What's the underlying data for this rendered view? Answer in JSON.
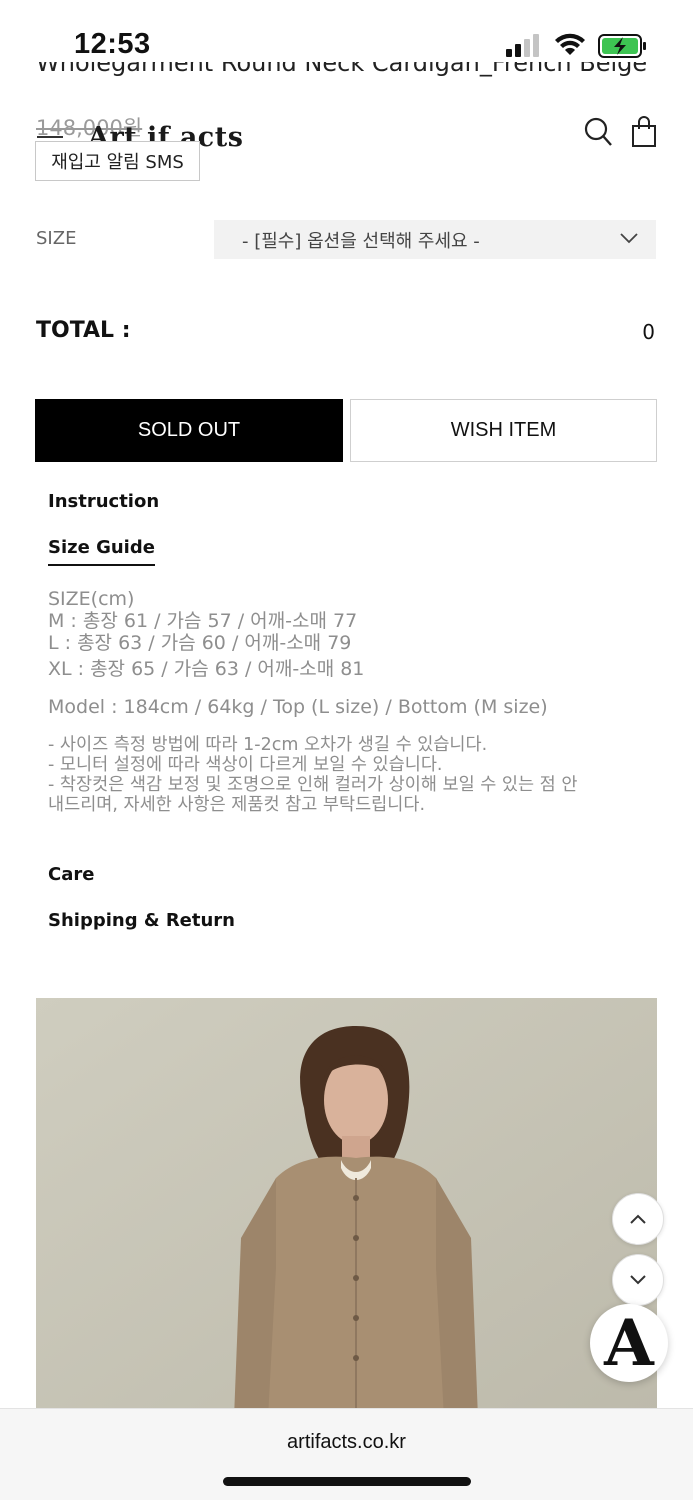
{
  "status_bar": {
    "time": "12:53"
  },
  "header": {
    "product_title": "Wholegarment Round Neck Cardigan_French Beige",
    "old_price": "148,000원",
    "logo_text": "Art if acts",
    "sms_button": "재입고 알림 SMS"
  },
  "options": {
    "size_label": "SIZE",
    "size_placeholder": "- [필수] 옵션을 선택해 주세요 -"
  },
  "total": {
    "label": "TOTAL :",
    "value": "0"
  },
  "buttons": {
    "sold_out": "SOLD OUT",
    "wish_item": "WISH ITEM"
  },
  "tabs": {
    "instruction": "Instruction",
    "size_guide": "Size Guide",
    "care": "Care",
    "shipping_return": "Shipping & Return"
  },
  "size_guide": {
    "heading": "SIZE(cm)",
    "rows": [
      "M : 총장 61 / 가슴 57 / 어깨-소매 77",
      "L : 총장 63 / 가슴 60 / 어깨-소매 79",
      "XL : 총장 65 / 가슴 63 / 어깨-소매 81"
    ],
    "model": "Model : 184cm / 64kg / Top (L size) / Bottom (M size)",
    "notes": [
      "- 사이즈 측정 방법에 따라 1-2cm 오차가 생길 수 있습니다.",
      "- 모니터 설정에 따라 색상이 다르게 보일 수 있습니다.",
      "- 착장컷은 색감 보정 및 조명으로 인해 컬러가 상이해 보일 수 있는 점 안",
      "내드리며, 자세한 사항은 제품컷 참고 부탁드립니다."
    ]
  },
  "floating": {
    "logo_letter": "A"
  },
  "browser": {
    "url": "artifacts.co.kr"
  },
  "colors": {
    "primary_button": "#000000",
    "guide_text": "#8e8e8e",
    "photo_background": "#c9c6b8",
    "cardigan": "#a88f72"
  }
}
